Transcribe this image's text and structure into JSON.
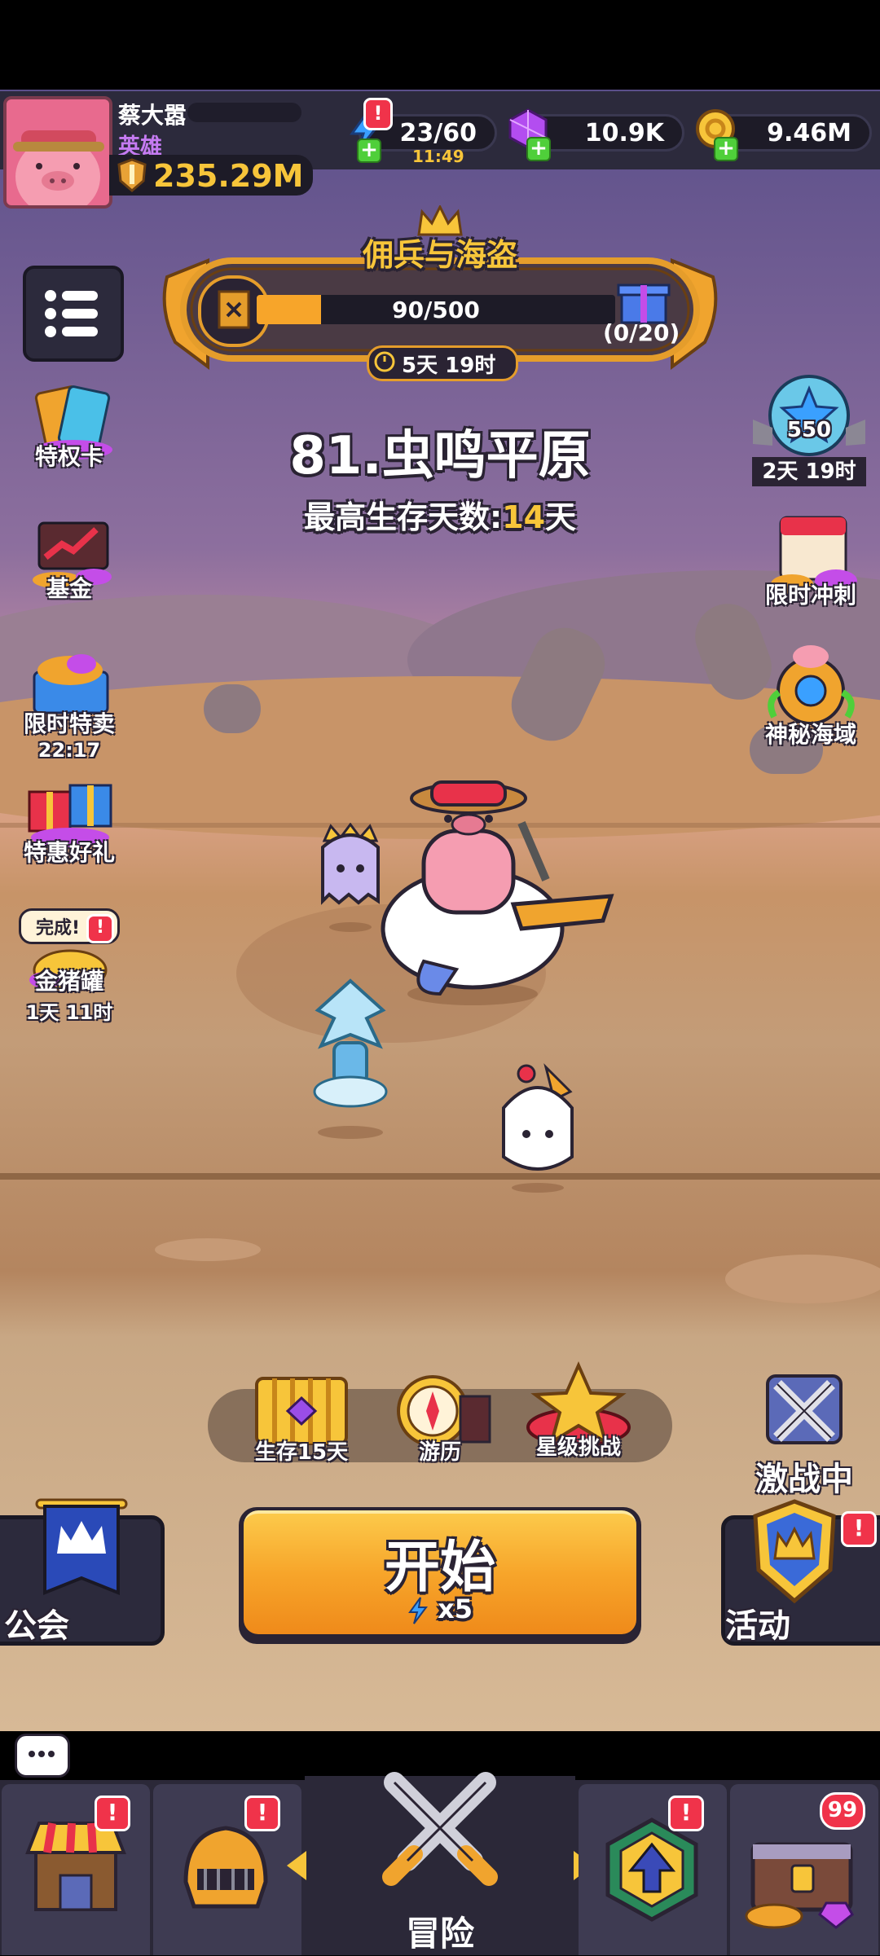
{
  "player": {
    "name": "蔡大嚣",
    "rank": "英雄",
    "power": "235.29M"
  },
  "resources": {
    "energy": "23/60",
    "energy_timer": "11:49",
    "gems": "10.9K",
    "gold": "9.46M"
  },
  "event": {
    "title": "佣兵与海盗",
    "progress_text": "90/500",
    "progress_fraction": 0.18,
    "reward_count": "(0/20)",
    "timer": "5天 19时"
  },
  "stage": {
    "name": "81.虫鸣平原",
    "best_prefix": "最高生存天数:",
    "best_days": "14",
    "best_suffix": "天"
  },
  "left_menu": {
    "privilege": "特权卡",
    "fund": "基金",
    "limited_sale": "限时特卖",
    "limited_sale_timer": "22:17",
    "special_gift": "特惠好礼",
    "piggy_done": "完成!",
    "piggy": "金猪罐",
    "piggy_timer": "1天 11时"
  },
  "right_menu": {
    "star_count": "550",
    "star_timer": "2天 19时",
    "sprint": "限时冲刺",
    "mystery_sea": "神秘海域"
  },
  "modes": {
    "survive": "生存15天",
    "travel": "游历",
    "star_challenge": "星级挑战",
    "battle": "激战中"
  },
  "actions": {
    "guild": "公会",
    "start": "开始",
    "start_cost": "x5",
    "activity": "活动"
  },
  "nav": {
    "adventure": "冒险",
    "chest_badge": "99",
    "alert": "!"
  },
  "colors": {
    "accent_orange": "#f7a52a",
    "gold_text": "#f7c53a",
    "alert_red": "#f0334a"
  }
}
